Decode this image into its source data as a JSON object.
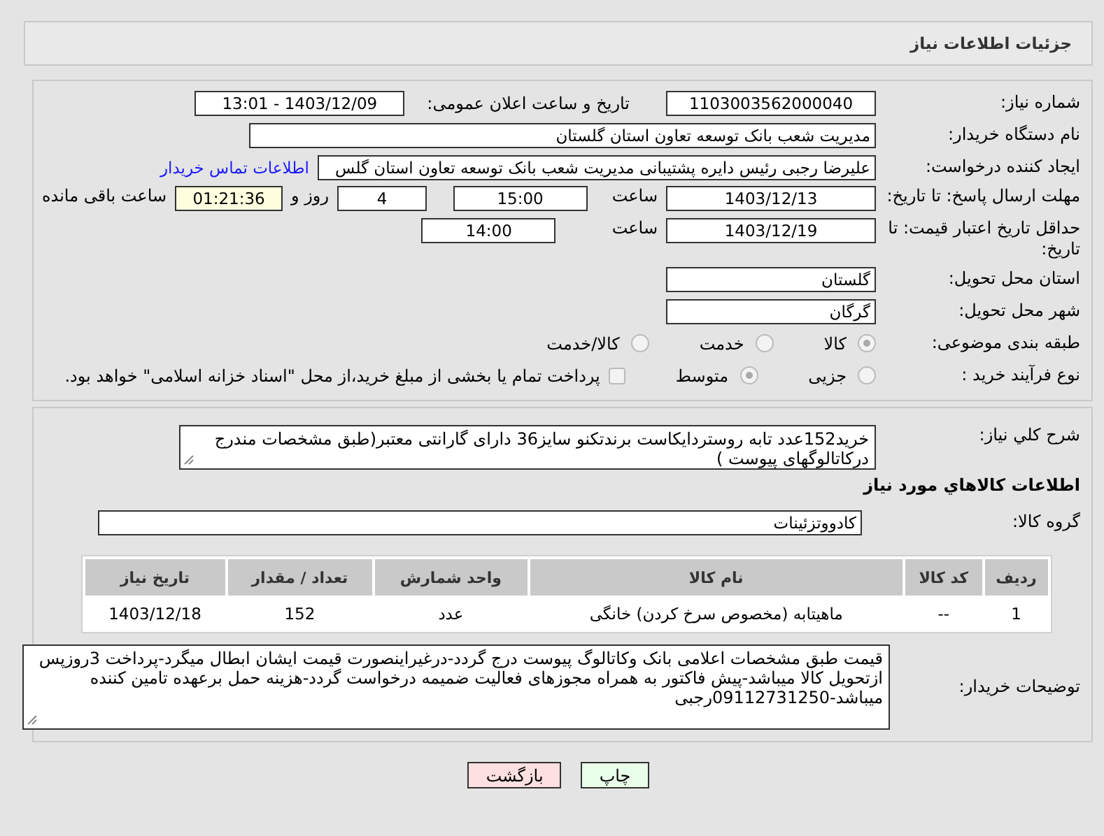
{
  "header": {
    "title": "جزئیات اطلاعات نیاز"
  },
  "need_number": {
    "label": "شماره نیاز:",
    "value": "1103003562000040"
  },
  "announce": {
    "label": "تاریخ و ساعت اعلان عمومی:",
    "value": "1403/12/09 - 13:01"
  },
  "buyer_org": {
    "label": "نام دستگاه خریدار:",
    "value": "مدیریت شعب بانک توسعه تعاون استان گلستان"
  },
  "requester": {
    "label": "ایجاد کننده درخواست:",
    "value": "علیرضا رجبی رئیس دایره پشتیبانی مدیریت شعب بانک توسعه تعاون استان گلس",
    "link": "اطلاعات تماس خریدار"
  },
  "deadline": {
    "label": "مهلت ارسال پاسخ: تا تاریخ:",
    "date": "1403/12/13",
    "time_label": "ساعت",
    "time": "15:00",
    "days": "4",
    "days_label": "روز و",
    "remaining": "01:21:36",
    "remaining_label": "ساعت باقی مانده"
  },
  "validity": {
    "label": "حداقل تاریخ اعتبار قیمت: تا تاریخ:",
    "date": "1403/12/19",
    "time_label": "ساعت",
    "time": "14:00"
  },
  "province": {
    "label": "استان محل تحویل:",
    "value": "گلستان"
  },
  "city": {
    "label": "شهر محل تحویل:",
    "value": "گرگان"
  },
  "category": {
    "label": "طبقه بندی موضوعی:",
    "options": [
      {
        "label": "کالا",
        "selected": true
      },
      {
        "label": "خدمت",
        "selected": false
      },
      {
        "label": "کالا/خدمت",
        "selected": false
      }
    ]
  },
  "purchase_type": {
    "label": "نوع فرآیند خرید :",
    "options": [
      {
        "label": "جزیی",
        "selected": false
      },
      {
        "label": "متوسط",
        "selected": true
      }
    ],
    "payment_checked": false,
    "payment_note": "پرداخت تمام یا بخشی از مبلغ خرید،از محل \"اسناد خزانه اسلامی\" خواهد بود."
  },
  "description": {
    "label": "شرح کلي نياز:",
    "value": "خرید152عدد تابه روستردایکاست برندتکنو سایز36 دارای گارانتی معتبر(طبق مشخصات مندرج درکاتالوگهای پیوست )"
  },
  "goods_heading": "اطلاعات كالاهاي مورد نياز",
  "goods_group": {
    "label": "گروه کالا:",
    "value": "کادووتزئینات"
  },
  "table": {
    "columns": [
      "ردیف",
      "کد کالا",
      "نام کالا",
      "واحد شمارش",
      "تعداد / مقدار",
      "تاریخ نیاز"
    ],
    "rows": [
      [
        "1",
        "--",
        "ماهیتابه (مخصوص سرخ کردن) خانگی",
        "عدد",
        "152",
        "1403/12/18"
      ]
    ]
  },
  "buyer_notes": {
    "label": "توضیحات خریدار:",
    "value": "قیمت  طبق مشخصات اعلامی بانک وکاتالوگ پیوست درج گردد-درغیراینصورت قیمت ایشان ابطال میگرد-پرداخت  3روزپس ازتحویل کالا  میباشد-پیش فاکتور به همراه مجوزهای فعالیت  ضمیمه درخواست گردد-هزینه حمل برعهده تامین کننده میباشد-09112731250رجبی"
  },
  "buttons": [
    {
      "kind": "print",
      "label": "چاپ"
    },
    {
      "kind": "back",
      "label": "بازگشت"
    }
  ]
}
